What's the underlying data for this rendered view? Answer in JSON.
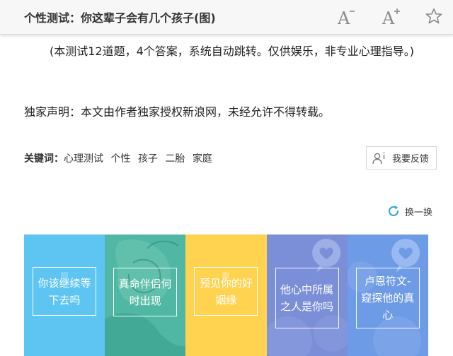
{
  "header": {
    "title": "个性测试：你这辈子会有几个孩子(图)",
    "font_decrease_label": "A",
    "font_increase_label": "A",
    "icons": [
      "font-decrease-icon",
      "font-increase-icon",
      "star-icon"
    ]
  },
  "article": {
    "intro": "(本测试12道题，4个答案，系统自动跳转。仅供娱乐，非专业心理指导。)",
    "declaration": "独家声明：本文由作者独家授权新浪网，未经允许不得转载。"
  },
  "keywords": {
    "label": "关键词：",
    "items": [
      "心理测试",
      "个性",
      "孩子",
      "二胎",
      "家庭"
    ]
  },
  "feedback": {
    "label": "我要反馈",
    "icon": "user-info-icon"
  },
  "refresh": {
    "label": "换一换",
    "icon": "refresh-icon"
  },
  "cards": [
    {
      "text": "你该继续等下去吗",
      "color": "#5ec5f2"
    },
    {
      "text": "真命伴侣何时出现",
      "color": "#49b5a2"
    },
    {
      "text": "预见你的好姻缘",
      "color": "#ffd24f"
    },
    {
      "text": "他心中所属之人是你吗",
      "color": "#7b8fd8",
      "icon": "heart-bubble-icon"
    },
    {
      "text": "卢恩符文-窥探他的真心",
      "color": "#6e9be6",
      "icon": "heart-bubble-icon"
    }
  ]
}
